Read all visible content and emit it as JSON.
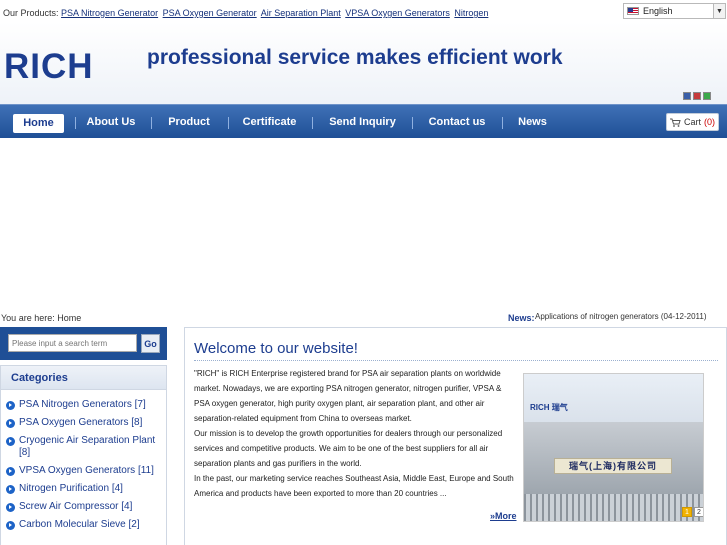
{
  "topbar": {
    "products_label": "Our Products:",
    "product_links": [
      "PSA Nitrogen Generator",
      "PSA Oxygen Generator",
      "Air Separation Plant",
      "VPSA Oxygen Generators",
      "Nitrogen"
    ],
    "language": "English"
  },
  "header": {
    "logo": "RICH",
    "slogan": "professional service makes efficient work"
  },
  "swatches": [
    "#3a5fa8",
    "#c63b3b",
    "#3aa84a"
  ],
  "nav": {
    "items": [
      {
        "label": "Home",
        "active": true
      },
      {
        "label": "About Us"
      },
      {
        "label": "Product"
      },
      {
        "label": "Certificate"
      },
      {
        "label": "Send Inquiry"
      },
      {
        "label": "Contact us"
      },
      {
        "label": "News"
      }
    ],
    "cart_label": "Cart",
    "cart_count": "(0)"
  },
  "breadcrumb": "You are here: Home",
  "news": {
    "label": "News:",
    "text": "Applications of nitrogen generators (04-12-2011)"
  },
  "search": {
    "placeholder": "Please input a search term",
    "button": "Go"
  },
  "categories": {
    "title": "Categories",
    "items": [
      "PSA Nitrogen Generators [7]",
      "PSA Oxygen Generators [8]",
      "Cryogenic Air Separation Plant [8]",
      "VPSA Oxygen Generators [11]",
      "Nitrogen Purification [4]",
      "Screw Air Compressor [4]",
      "Carbon Molecular Sieve [2]"
    ]
  },
  "welcome": {
    "title": "Welcome to our website!",
    "paragraphs": [
      "\"RICH\" is RICH Enterprise registered brand for PSA air separation plants on worldwide market. Nowadays, we are exporting PSA nitrogen generator, nitrogen purifier, VPSA & PSA oxygen generator, high purity oxygen plant, air separation plant, and other air separation-related equipment from China to overseas market.",
      "Our mission is to develop the growth opportunities for dealers through our personalized services and competitive products. We aim to be one of the best suppliers for all air separation plants and gas purifiers in the world.",
      "In the past, our marketing service reaches Southeast Asia, Middle East, Europe and South America and products have been exported to more than 20 countries ..."
    ],
    "more": "»More"
  },
  "photo": {
    "sign_logo": "RICH 瑞气",
    "sign": "瑞气(上海)有限公司",
    "slides": [
      "1",
      "2"
    ],
    "active_slide": "1"
  }
}
